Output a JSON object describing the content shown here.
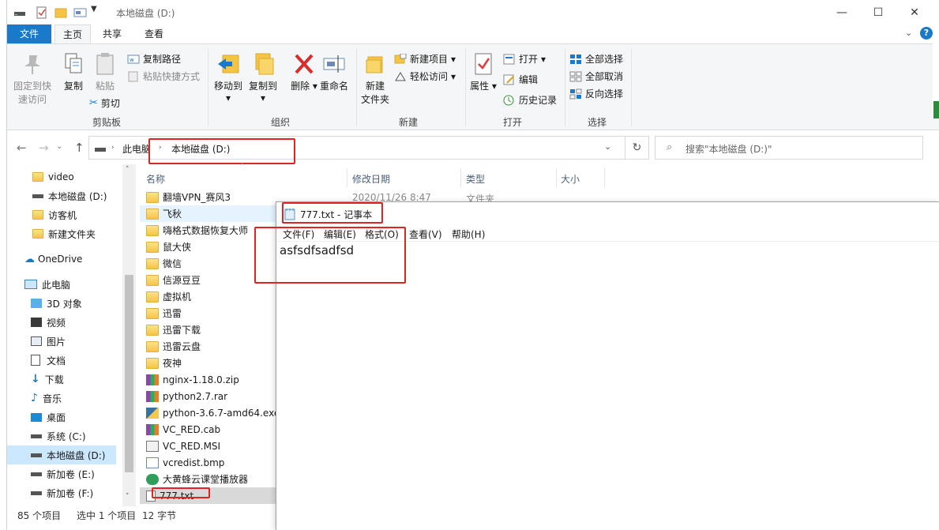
{
  "window": {
    "title": "本地磁盘 (D:)",
    "controls": [
      "—",
      "☐",
      "✕"
    ]
  },
  "ribbon_tabs": [
    "文件",
    "主页",
    "共享",
    "查看"
  ],
  "ribbon": {
    "clipboard": {
      "pin": "固定到快速访问",
      "pin_line1": "固定到快",
      "pin_line2": "速访问",
      "copy": "复制",
      "paste": "粘贴",
      "copy_path": "复制路径",
      "paste_shortcut": "粘贴快捷方式",
      "cut": "剪切",
      "label": "剪贴板"
    },
    "organize": {
      "move_to": "移动到",
      "copy_to": "复制到",
      "delete": "删除",
      "rename": "重命名",
      "label": "组织"
    },
    "new": {
      "new_folder_line1": "新建",
      "new_folder_line2": "文件夹",
      "new_item": "新建项目",
      "easy_access": "轻松访问",
      "label": "新建"
    },
    "open": {
      "properties": "属性",
      "open": "打开",
      "edit": "编辑",
      "history": "历史记录",
      "label": "打开"
    },
    "select": {
      "select_all": "全部选择",
      "select_none": "全部取消",
      "invert": "反向选择",
      "label": "选择"
    }
  },
  "address": {
    "crumb1": "此电脑",
    "crumb2": "本地磁盘 (D:)",
    "search_placeholder": "搜索\"本地磁盘 (D:)\""
  },
  "sidebar": {
    "items": [
      "video",
      "本地磁盘 (D:)",
      "访客机",
      "新建文件夹",
      "OneDrive",
      "此电脑",
      "3D 对象",
      "视频",
      "图片",
      "文档",
      "下载",
      "音乐",
      "桌面",
      "系统 (C:)",
      "本地磁盘 (D:)",
      "新加卷 (E:)",
      "新加卷 (F:)"
    ]
  },
  "columns": [
    "名称",
    "修改日期",
    "类型",
    "大小"
  ],
  "files": [
    {
      "name": "翻墙VPN_赛风3",
      "kind": "folder",
      "date": "2020/11/26 8:47",
      "type": "文件夹"
    },
    {
      "name": "飞秋",
      "kind": "folder"
    },
    {
      "name": "嗨格式数据恢复大师",
      "kind": "folder"
    },
    {
      "name": "鼠大侠",
      "kind": "folder"
    },
    {
      "name": "微信",
      "kind": "folder"
    },
    {
      "name": "信源豆豆",
      "kind": "folder"
    },
    {
      "name": "虚拟机",
      "kind": "folder"
    },
    {
      "name": "迅雷",
      "kind": "folder"
    },
    {
      "name": "迅雷下载",
      "kind": "folder"
    },
    {
      "name": "迅雷云盘",
      "kind": "folder"
    },
    {
      "name": "夜神",
      "kind": "folder"
    },
    {
      "name": "nginx-1.18.0.zip",
      "kind": "zip"
    },
    {
      "name": "python2.7.rar",
      "kind": "rar"
    },
    {
      "name": "python-3.6.7-amd64.exe",
      "kind": "exe"
    },
    {
      "name": "VC_RED.cab",
      "kind": "cab"
    },
    {
      "name": "VC_RED.MSI",
      "kind": "msi"
    },
    {
      "name": "vcredist.bmp",
      "kind": "bmp"
    },
    {
      "name": "大黄蜂云课堂播放器",
      "kind": "app"
    },
    {
      "name": "777.txt",
      "kind": "txt"
    }
  ],
  "status": {
    "count": "85 个项目",
    "selected": "选中 1 个项目",
    "size": "12 字节"
  },
  "notepad": {
    "title": "777.txt - 记事本",
    "menu": [
      "文件(F)",
      "编辑(E)",
      "格式(O)",
      "查看(V)",
      "帮助(H)"
    ],
    "content": "asfsdfsadfsd"
  },
  "colors": {
    "file_tab": "#1979ca",
    "selection": "#cce8ff",
    "annotation": "#e02424"
  }
}
